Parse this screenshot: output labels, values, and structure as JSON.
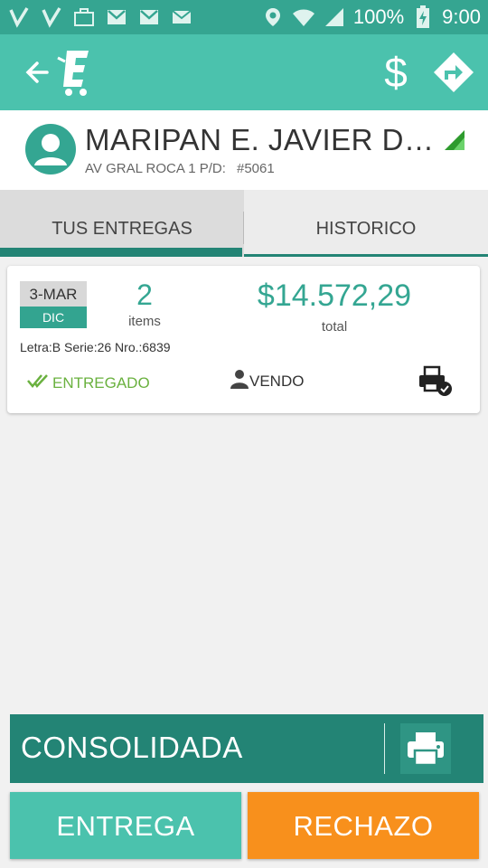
{
  "status_bar": {
    "battery": "100%",
    "time": "9:00",
    "icons": [
      "check-icon",
      "check-icon",
      "briefcase-icon",
      "gmail-icon",
      "gmail-icon",
      "mail-icon",
      "location-icon",
      "wifi-icon",
      "signal-icon",
      "battery-charging-icon"
    ]
  },
  "app_bar": {
    "icons": [
      "back-arrow-icon",
      "app-logo-icon",
      "dollar-icon",
      "route-icon"
    ],
    "dollar_symbol": "$"
  },
  "client": {
    "name": "MARIPAN E. JAVIER DESCOTTE",
    "address": "AV GRAL ROCA 1 P/D:",
    "id": "#5061"
  },
  "tabs": [
    {
      "label": "TUS ENTREGAS",
      "selected": true
    },
    {
      "label": "HISTORICO",
      "selected": false
    }
  ],
  "delivery": {
    "date_top": "3-MAR",
    "date_bottom": "DIC",
    "items_count": "2",
    "items_label": "items",
    "total_amount": "$14.572,29",
    "total_label": "total",
    "document": "Letra:B Serie:26 Nro.:6839",
    "status": "ENTREGADO",
    "seller": "VENDO"
  },
  "consolidated": {
    "label": "CONSOLIDADA"
  },
  "actions": {
    "entrega_label": "ENTREGA",
    "rechazo_label": "RECHAZO"
  },
  "colors": {
    "primary": "#4bc2ad",
    "primary_dark": "#238475",
    "status_bar": "#35a591",
    "accent": "#f8901c",
    "status_green": "#6ab13f"
  }
}
